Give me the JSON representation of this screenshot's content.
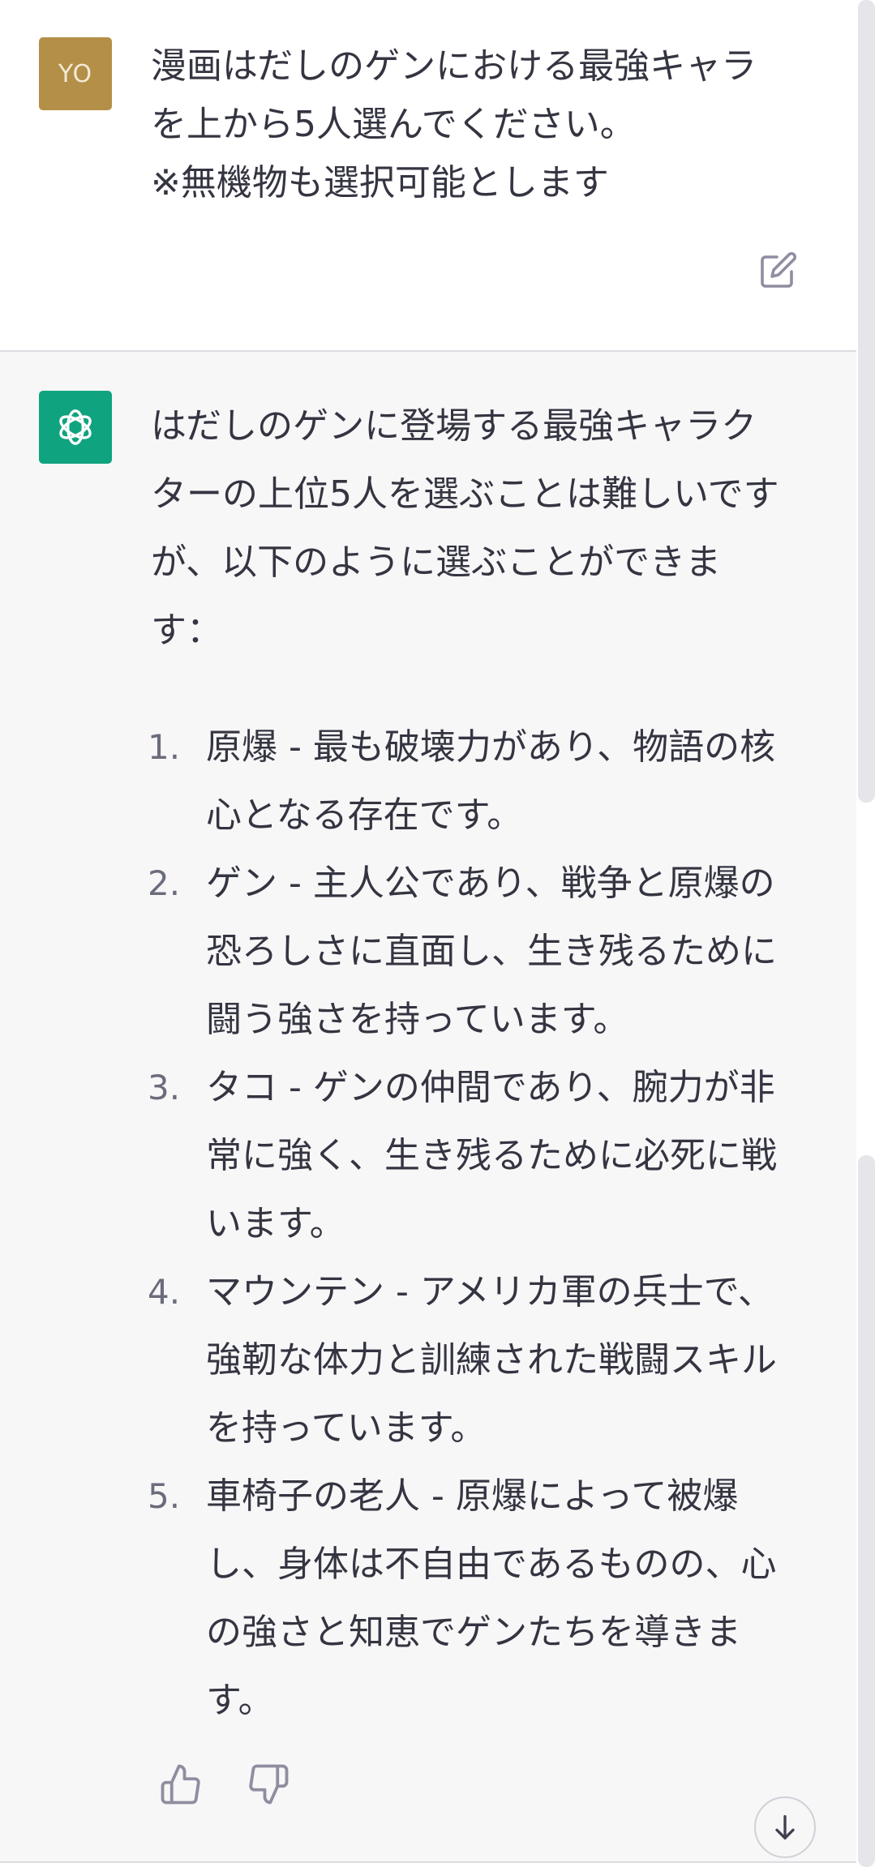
{
  "user_message": {
    "avatar_initials": "YO",
    "avatar_color": "#b48f47",
    "lines": [
      "漫画はだしのゲンにおける最強キャラ",
      "を上から5人選んでください。",
      "※無機物も選択可能とします"
    ],
    "edit_icon": "edit-icon"
  },
  "assistant_message": {
    "avatar_icon": "openai-logo-icon",
    "avatar_color": "#10a37f",
    "intro_lines": [
      "はだしのゲンに登場する最強キャラク",
      "ターの上位5人を選ぶことは難しいです",
      "が、以下のように選ぶことができま",
      "す："
    ],
    "items": [
      {
        "number": "1.",
        "lines": [
          "原爆 - 最も破壊力があり、物語の核",
          "心となる存在です。"
        ]
      },
      {
        "number": "2.",
        "lines": [
          "ゲン - 主人公であり、戦争と原爆の",
          "恐ろしさに直面し、生き残るために",
          "闘う強さを持っています。"
        ]
      },
      {
        "number": "3.",
        "lines": [
          "タコ - ゲンの仲間であり、腕力が非",
          "常に強く、生き残るために必死に戦",
          "います。"
        ]
      },
      {
        "number": "4.",
        "lines": [
          "マウンテン - アメリカ軍の兵士で、",
          "強靭な体力と訓練された戦闘スキル",
          "を持っています。"
        ]
      },
      {
        "number": "5.",
        "lines": [
          "車椅子の老人 - 原爆によって被爆",
          "し、身体は不自由であるものの、心",
          "の強さと知恵でゲンたちを導きま",
          "す。"
        ]
      }
    ],
    "feedback_icons": [
      "thumbs-up-icon",
      "thumbs-down-icon"
    ]
  },
  "scroll_button_icon": "arrow-down-icon"
}
